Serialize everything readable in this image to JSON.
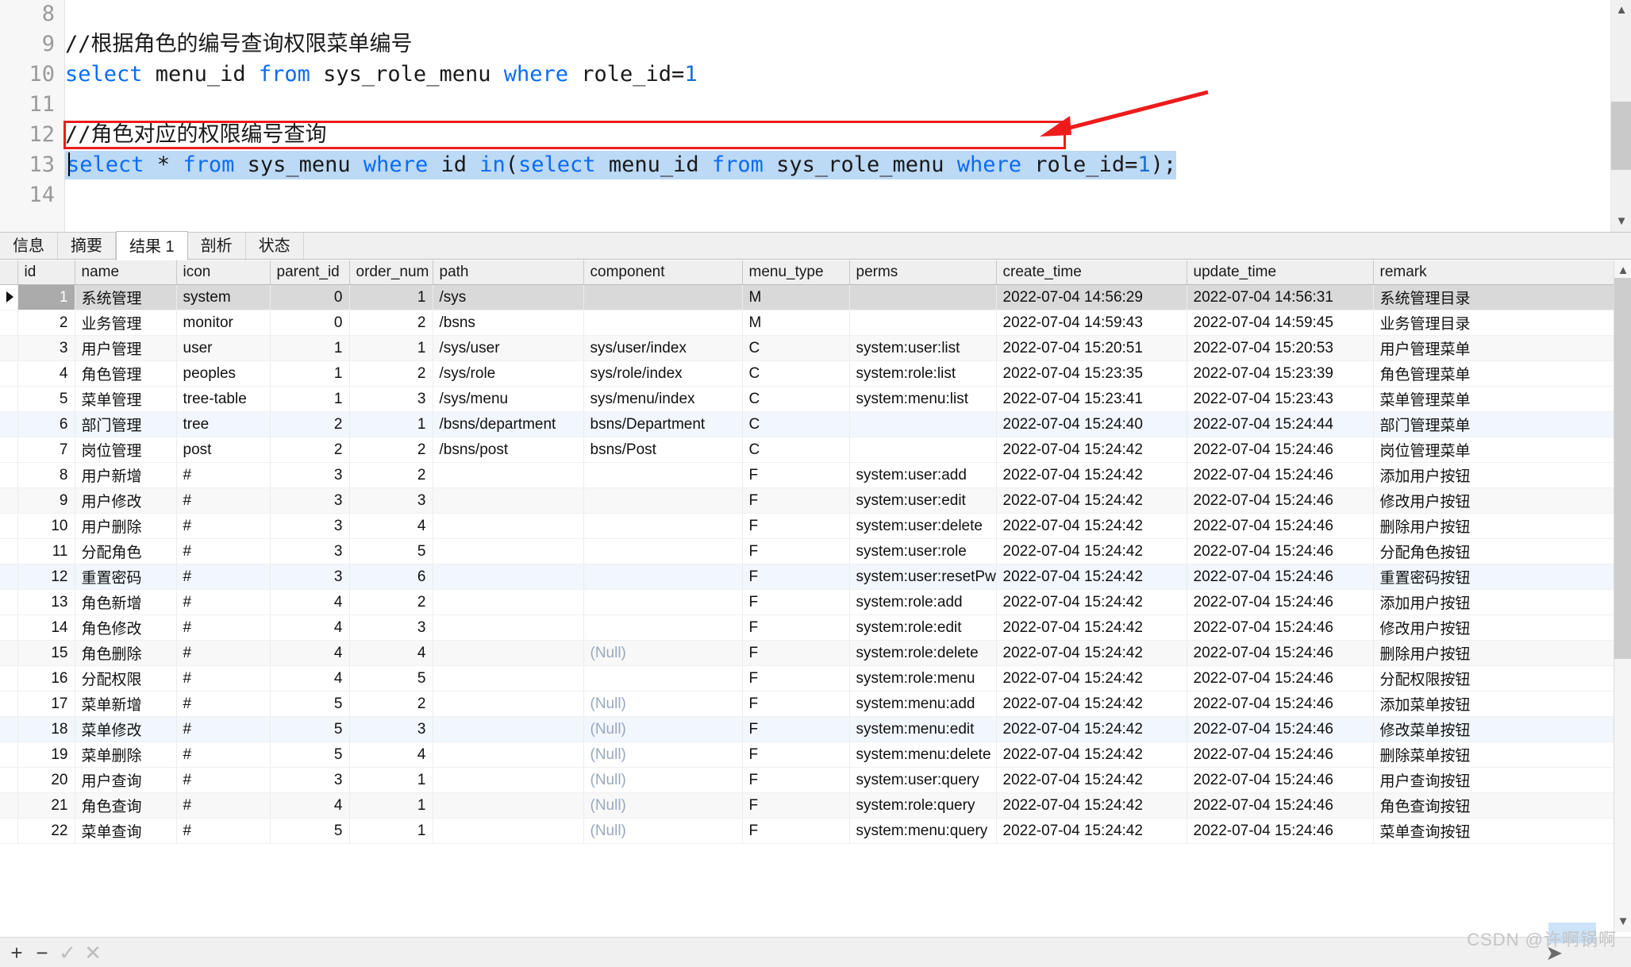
{
  "colors": {
    "keyword": "#0a6cf5",
    "selection": "#bcd9f5",
    "annotation_red": "#ee1b1b",
    "row_selected": "#d9d9d9",
    "null_text": "#9aa8bd"
  },
  "editor": {
    "line_numbers": [
      "8",
      "9",
      "10",
      "11",
      "12",
      "13",
      "14"
    ],
    "lines": [
      {
        "n": "8",
        "segments": []
      },
      {
        "n": "9",
        "segments": [
          {
            "t": "//根据角色的编号查询权限菜单编号",
            "k": "cmt"
          }
        ]
      },
      {
        "n": "10",
        "segments": [
          {
            "t": "select",
            "k": "kw"
          },
          {
            "t": " menu_id ",
            "k": ""
          },
          {
            "t": "from",
            "k": "kw"
          },
          {
            "t": " sys_role_menu ",
            "k": ""
          },
          {
            "t": "where",
            "k": "kw"
          },
          {
            "t": " role_id=",
            "k": ""
          },
          {
            "t": "1",
            "k": "num-lit"
          }
        ]
      },
      {
        "n": "11",
        "segments": []
      },
      {
        "n": "12",
        "segments": [
          {
            "t": "//角色对应的权限编号查询",
            "k": "cmt"
          }
        ]
      },
      {
        "n": "13",
        "segments": [
          {
            "t": "select",
            "k": "kw"
          },
          {
            "t": " * ",
            "k": ""
          },
          {
            "t": "from",
            "k": "kw"
          },
          {
            "t": " sys_menu ",
            "k": ""
          },
          {
            "t": "where",
            "k": "kw"
          },
          {
            "t": " id ",
            "k": ""
          },
          {
            "t": "in",
            "k": "kw"
          },
          {
            "t": "(",
            "k": ""
          },
          {
            "t": "select",
            "k": "kw"
          },
          {
            "t": " menu_id ",
            "k": ""
          },
          {
            "t": "from",
            "k": "kw"
          },
          {
            "t": " sys_role_menu ",
            "k": ""
          },
          {
            "t": "where",
            "k": "kw"
          },
          {
            "t": " role_id=",
            "k": ""
          },
          {
            "t": "1",
            "k": "num-lit"
          },
          {
            "t": ");",
            "k": ""
          }
        ]
      },
      {
        "n": "14",
        "segments": []
      }
    ],
    "plain_lines": [
      "",
      "//根据角色的编号查询权限菜单编号",
      "select menu_id from sys_role_menu where role_id=1",
      "",
      "//角色对应的权限编号查询",
      "select * from sys_menu where id in(select menu_id from sys_role_menu where role_id=1);",
      ""
    ],
    "highlighted_line": "13",
    "annotation": "red-arrow-pointing-to-line-13"
  },
  "tabs": [
    {
      "label": "信息",
      "active": false
    },
    {
      "label": "摘要",
      "active": false
    },
    {
      "label": "结果 1",
      "active": true
    },
    {
      "label": "剖析",
      "active": false
    },
    {
      "label": "状态",
      "active": false
    }
  ],
  "grid": {
    "columns": [
      "id",
      "name",
      "icon",
      "parent_id",
      "order_num",
      "path",
      "component",
      "menu_type",
      "perms",
      "create_time",
      "update_time",
      "remark"
    ],
    "rows": [
      {
        "sel": true,
        "zebra": "",
        "id": "1",
        "name": "系统管理",
        "icon": "system",
        "parent_id": "0",
        "order_num": "1",
        "path": "/sys",
        "component": "",
        "menu_type": "M",
        "perms": "",
        "create_time": "2022-07-04 14:56:29",
        "update_time": "2022-07-04 14:56:31",
        "remark": "系统管理目录"
      },
      {
        "sel": false,
        "zebra": "",
        "id": "2",
        "name": "业务管理",
        "icon": "monitor",
        "parent_id": "0",
        "order_num": "2",
        "path": "/bsns",
        "component": "",
        "menu_type": "M",
        "perms": "",
        "create_time": "2022-07-04 14:59:43",
        "update_time": "2022-07-04 14:59:45",
        "remark": "业务管理目录"
      },
      {
        "sel": false,
        "zebra": "gray",
        "id": "3",
        "name": "用户管理",
        "icon": "user",
        "parent_id": "1",
        "order_num": "1",
        "path": "/sys/user",
        "component": "sys/user/index",
        "menu_type": "C",
        "perms": "system:user:list",
        "create_time": "2022-07-04 15:20:51",
        "update_time": "2022-07-04 15:20:53",
        "remark": "用户管理菜单"
      },
      {
        "sel": false,
        "zebra": "",
        "id": "4",
        "name": "角色管理",
        "icon": "peoples",
        "parent_id": "1",
        "order_num": "2",
        "path": "/sys/role",
        "component": "sys/role/index",
        "menu_type": "C",
        "perms": "system:role:list",
        "create_time": "2022-07-04 15:23:35",
        "update_time": "2022-07-04 15:23:39",
        "remark": "角色管理菜单"
      },
      {
        "sel": false,
        "zebra": "",
        "id": "5",
        "name": "菜单管理",
        "icon": "tree-table",
        "parent_id": "1",
        "order_num": "3",
        "path": "/sys/menu",
        "component": "sys/menu/index",
        "menu_type": "C",
        "perms": "system:menu:list",
        "create_time": "2022-07-04 15:23:41",
        "update_time": "2022-07-04 15:23:43",
        "remark": "菜单管理菜单"
      },
      {
        "sel": false,
        "zebra": "blue",
        "id": "6",
        "name": "部门管理",
        "icon": "tree",
        "parent_id": "2",
        "order_num": "1",
        "path": "/bsns/department",
        "component": "bsns/Department",
        "menu_type": "C",
        "perms": "",
        "create_time": "2022-07-04 15:24:40",
        "update_time": "2022-07-04 15:24:44",
        "remark": "部门管理菜单"
      },
      {
        "sel": false,
        "zebra": "",
        "id": "7",
        "name": "岗位管理",
        "icon": "post",
        "parent_id": "2",
        "order_num": "2",
        "path": "/bsns/post",
        "component": "bsns/Post",
        "menu_type": "C",
        "perms": "",
        "create_time": "2022-07-04 15:24:42",
        "update_time": "2022-07-04 15:24:46",
        "remark": "岗位管理菜单"
      },
      {
        "sel": false,
        "zebra": "",
        "id": "8",
        "name": "用户新增",
        "icon": "#",
        "parent_id": "3",
        "order_num": "2",
        "path": "",
        "component": "",
        "menu_type": "F",
        "perms": "system:user:add",
        "create_time": "2022-07-04 15:24:42",
        "update_time": "2022-07-04 15:24:46",
        "remark": "添加用户按钮"
      },
      {
        "sel": false,
        "zebra": "gray",
        "id": "9",
        "name": "用户修改",
        "icon": "#",
        "parent_id": "3",
        "order_num": "3",
        "path": "",
        "component": "",
        "menu_type": "F",
        "perms": "system:user:edit",
        "create_time": "2022-07-04 15:24:42",
        "update_time": "2022-07-04 15:24:46",
        "remark": "修改用户按钮"
      },
      {
        "sel": false,
        "zebra": "",
        "id": "10",
        "name": "用户删除",
        "icon": "#",
        "parent_id": "3",
        "order_num": "4",
        "path": "",
        "component": "",
        "menu_type": "F",
        "perms": "system:user:delete",
        "create_time": "2022-07-04 15:24:42",
        "update_time": "2022-07-04 15:24:46",
        "remark": "删除用户按钮"
      },
      {
        "sel": false,
        "zebra": "",
        "id": "11",
        "name": "分配角色",
        "icon": "#",
        "parent_id": "3",
        "order_num": "5",
        "path": "",
        "component": "",
        "menu_type": "F",
        "perms": "system:user:role",
        "create_time": "2022-07-04 15:24:42",
        "update_time": "2022-07-04 15:24:46",
        "remark": "分配角色按钮"
      },
      {
        "sel": false,
        "zebra": "blue",
        "id": "12",
        "name": "重置密码",
        "icon": "#",
        "parent_id": "3",
        "order_num": "6",
        "path": "",
        "component": "",
        "menu_type": "F",
        "perms": "system:user:resetPw",
        "create_time": "2022-07-04 15:24:42",
        "update_time": "2022-07-04 15:24:46",
        "remark": "重置密码按钮"
      },
      {
        "sel": false,
        "zebra": "",
        "id": "13",
        "name": "角色新增",
        "icon": "#",
        "parent_id": "4",
        "order_num": "2",
        "path": "",
        "component": "",
        "menu_type": "F",
        "perms": "system:role:add",
        "create_time": "2022-07-04 15:24:42",
        "update_time": "2022-07-04 15:24:46",
        "remark": "添加用户按钮"
      },
      {
        "sel": false,
        "zebra": "",
        "id": "14",
        "name": "角色修改",
        "icon": "#",
        "parent_id": "4",
        "order_num": "3",
        "path": "",
        "component": "",
        "menu_type": "F",
        "perms": "system:role:edit",
        "create_time": "2022-07-04 15:24:42",
        "update_time": "2022-07-04 15:24:46",
        "remark": "修改用户按钮"
      },
      {
        "sel": false,
        "zebra": "gray",
        "id": "15",
        "name": "角色删除",
        "icon": "#",
        "parent_id": "4",
        "order_num": "4",
        "path": "",
        "component": "(Null)",
        "menu_type": "F",
        "perms": "system:role:delete",
        "create_time": "2022-07-04 15:24:42",
        "update_time": "2022-07-04 15:24:46",
        "remark": "删除用户按钮"
      },
      {
        "sel": false,
        "zebra": "",
        "id": "16",
        "name": "分配权限",
        "icon": "#",
        "parent_id": "4",
        "order_num": "5",
        "path": "",
        "component": "",
        "menu_type": "F",
        "perms": "system:role:menu",
        "create_time": "2022-07-04 15:24:42",
        "update_time": "2022-07-04 15:24:46",
        "remark": "分配权限按钮"
      },
      {
        "sel": false,
        "zebra": "",
        "id": "17",
        "name": "菜单新增",
        "icon": "#",
        "parent_id": "5",
        "order_num": "2",
        "path": "",
        "component": "(Null)",
        "menu_type": "F",
        "perms": "system:menu:add",
        "create_time": "2022-07-04 15:24:42",
        "update_time": "2022-07-04 15:24:46",
        "remark": "添加菜单按钮"
      },
      {
        "sel": false,
        "zebra": "blue",
        "id": "18",
        "name": "菜单修改",
        "icon": "#",
        "parent_id": "5",
        "order_num": "3",
        "path": "",
        "component": "(Null)",
        "menu_type": "F",
        "perms": "system:menu:edit",
        "create_time": "2022-07-04 15:24:42",
        "update_time": "2022-07-04 15:24:46",
        "remark": "修改菜单按钮"
      },
      {
        "sel": false,
        "zebra": "",
        "id": "19",
        "name": "菜单删除",
        "icon": "#",
        "parent_id": "5",
        "order_num": "4",
        "path": "",
        "component": "(Null)",
        "menu_type": "F",
        "perms": "system:menu:delete",
        "create_time": "2022-07-04 15:24:42",
        "update_time": "2022-07-04 15:24:46",
        "remark": "删除菜单按钮"
      },
      {
        "sel": false,
        "zebra": "",
        "id": "20",
        "name": "用户查询",
        "icon": "#",
        "parent_id": "3",
        "order_num": "1",
        "path": "",
        "component": "(Null)",
        "menu_type": "F",
        "perms": "system:user:query",
        "create_time": "2022-07-04 15:24:42",
        "update_time": "2022-07-04 15:24:46",
        "remark": "用户查询按钮"
      },
      {
        "sel": false,
        "zebra": "gray",
        "id": "21",
        "name": "角色查询",
        "icon": "#",
        "parent_id": "4",
        "order_num": "1",
        "path": "",
        "component": "(Null)",
        "menu_type": "F",
        "perms": "system:role:query",
        "create_time": "2022-07-04 15:24:42",
        "update_time": "2022-07-04 15:24:46",
        "remark": "角色查询按钮"
      },
      {
        "sel": false,
        "zebra": "",
        "id": "22",
        "name": "菜单查询",
        "icon": "#",
        "parent_id": "5",
        "order_num": "1",
        "path": "",
        "component": "(Null)",
        "menu_type": "F",
        "perms": "system:menu:query",
        "create_time": "2022-07-04 15:24:42",
        "update_time": "2022-07-04 15:24:46",
        "remark": "菜单查询按钮"
      }
    ]
  },
  "bottom_toolbar": {
    "buttons": [
      {
        "name": "add-row-button",
        "glyph": "+",
        "enabled": true
      },
      {
        "name": "remove-row-button",
        "glyph": "−",
        "enabled": true
      },
      {
        "name": "apply-changes-button",
        "glyph": "✓",
        "enabled": false
      },
      {
        "name": "cancel-changes-button",
        "glyph": "✕",
        "enabled": false
      }
    ]
  },
  "watermark": {
    "text": "CSDN @许啊锅啊"
  }
}
